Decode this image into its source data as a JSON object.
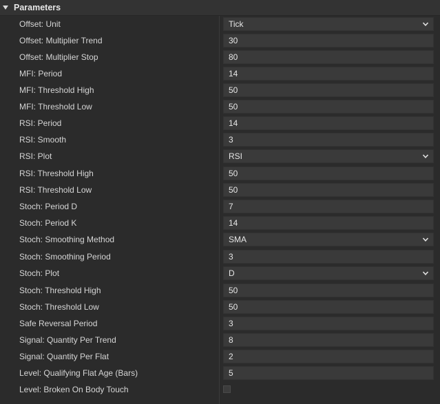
{
  "section": {
    "title": "Parameters"
  },
  "rows": [
    {
      "label": "Offset: Unit",
      "type": "select",
      "value": "Tick"
    },
    {
      "label": "Offset: Multiplier Trend",
      "type": "number",
      "value": "30"
    },
    {
      "label": "Offset: Multiplier Stop",
      "type": "number",
      "value": "80"
    },
    {
      "label": "MFI: Period",
      "type": "number",
      "value": "14"
    },
    {
      "label": "MFI: Threshold High",
      "type": "number",
      "value": "50"
    },
    {
      "label": "MFI: Threshold Low",
      "type": "number",
      "value": "50"
    },
    {
      "label": "RSI: Period",
      "type": "number",
      "value": "14"
    },
    {
      "label": "RSI: Smooth",
      "type": "number",
      "value": "3"
    },
    {
      "label": "RSI: Plot",
      "type": "select",
      "value": "RSI"
    },
    {
      "label": "RSI: Threshold High",
      "type": "number",
      "value": "50"
    },
    {
      "label": "RSI: Threshold Low",
      "type": "number",
      "value": "50"
    },
    {
      "label": "Stoch: Period D",
      "type": "number",
      "value": "7"
    },
    {
      "label": "Stoch: Period K",
      "type": "number",
      "value": "14"
    },
    {
      "label": "Stoch: Smoothing Method",
      "type": "select",
      "value": "SMA"
    },
    {
      "label": "Stoch: Smoothing Period",
      "type": "number",
      "value": "3"
    },
    {
      "label": "Stoch: Plot",
      "type": "select",
      "value": "D"
    },
    {
      "label": "Stoch: Threshold High",
      "type": "number",
      "value": "50"
    },
    {
      "label": "Stoch: Threshold Low",
      "type": "number",
      "value": "50"
    },
    {
      "label": "Safe Reversal Period",
      "type": "number",
      "value": "3"
    },
    {
      "label": "Signal: Quantity Per Trend",
      "type": "number",
      "value": "8"
    },
    {
      "label": "Signal: Quantity Per Flat",
      "type": "number",
      "value": "2"
    },
    {
      "label": "Level: Qualifying Flat Age (Bars)",
      "type": "number",
      "value": "5"
    },
    {
      "label": "Level: Broken On Body Touch",
      "type": "checkbox",
      "checked": false
    }
  ],
  "icons": {
    "caret": "caret-down-icon",
    "chevron": "chevron-down-icon"
  }
}
